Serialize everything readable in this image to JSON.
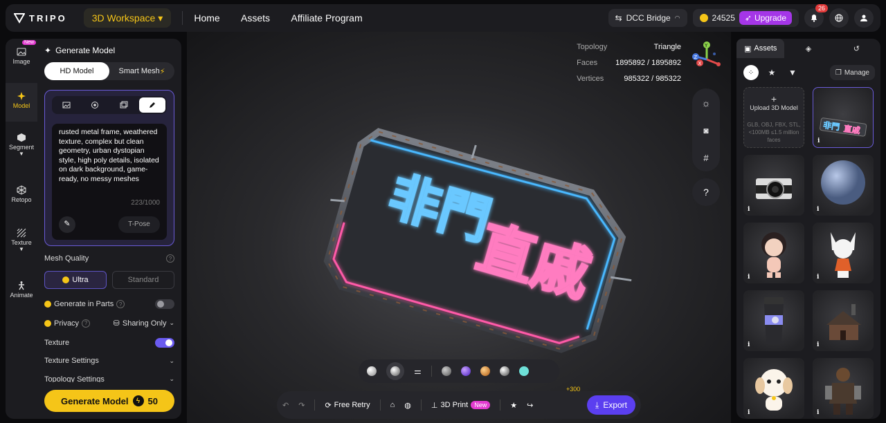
{
  "app": {
    "logo_text": "TRIPO",
    "workspace": "3D Workspace",
    "nav": [
      "Home",
      "Assets",
      "Affiliate Program"
    ]
  },
  "topbar": {
    "dcc_bridge": "DCC Bridge",
    "credits": "24525",
    "upgrade": "Upgrade",
    "notifications": "26"
  },
  "rail": {
    "items": [
      {
        "label": "Image",
        "badge": "New"
      },
      {
        "label": "Model"
      },
      {
        "label": "Segment"
      },
      {
        "label": "Retopo"
      },
      {
        "label": "Texture"
      },
      {
        "label": "Animate"
      }
    ]
  },
  "panel": {
    "title": "Generate Model",
    "modes": [
      "HD Model",
      "Smart Mesh"
    ],
    "prompt": "rusted metal frame, weathered texture, complex but clean geometry, urban dystopian style, high poly details, isolated on dark background, game-ready, no messy meshes",
    "char_count": "223/1000",
    "tpose": "T-Pose",
    "mesh_quality_label": "Mesh Quality",
    "quality_options": [
      "Ultra",
      "Standard"
    ],
    "generate_in_parts": "Generate in Parts",
    "privacy_label": "Privacy",
    "privacy_value": "Sharing Only",
    "texture_label": "Texture",
    "texture_settings": "Texture Settings",
    "topology_settings": "Topology Settings",
    "generate_button": "Generate Model",
    "generate_cost": "50",
    "colors": {
      "accent": "#f5c518",
      "purple": "#6a5bd8"
    }
  },
  "viewport": {
    "stats": [
      {
        "k": "Topology",
        "v": "Triangle"
      },
      {
        "k": "Faces",
        "v": "1895892 / 1895892"
      },
      {
        "k": "Vertices",
        "v": "985322 / 985322"
      }
    ],
    "gizmo_axes": [
      "Y",
      "Z",
      "X"
    ],
    "help": "?",
    "sign_text_top": "非門",
    "sign_text_bottom": "直戚",
    "materials": [
      "#9a9a9e",
      "#7b3ff0",
      "#e08a2c",
      "#b8b8bc",
      "#6ee0d8"
    ],
    "bottom": {
      "free_retry": "Free Retry",
      "print": "3D Print",
      "print_badge": "New",
      "plus": "+300",
      "export": "Export"
    }
  },
  "assets": {
    "tabs": [
      "Assets",
      "",
      ""
    ],
    "manage": "Manage",
    "upload_title": "Upload 3D Model",
    "upload_sub": "GLB, OBJ, FBX, STL, <100MB ≤1.5 million faces",
    "tiles": [
      "sign",
      "camera",
      "sphere",
      "girl",
      "fox",
      "cup",
      "house",
      "dog",
      "warrior"
    ],
    "info": "i"
  }
}
